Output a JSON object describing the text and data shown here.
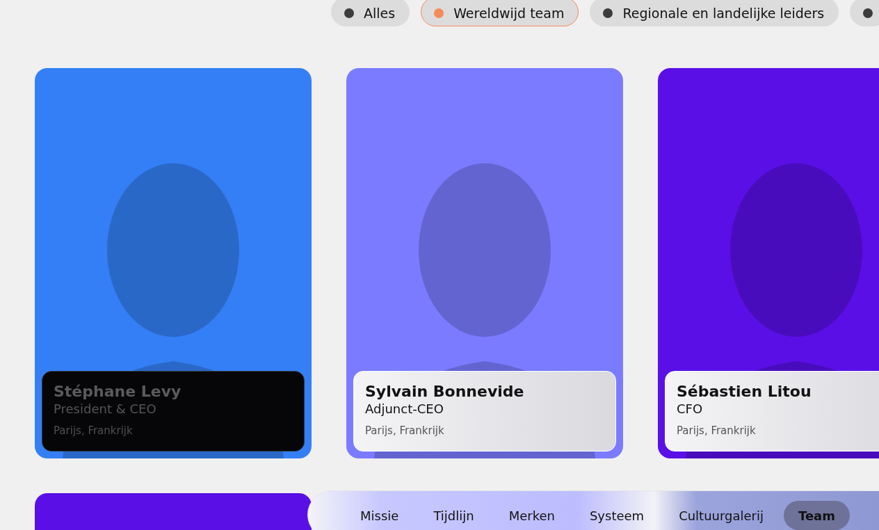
{
  "filters": [
    {
      "label": "Alles",
      "selected": false
    },
    {
      "label": "Wereldwijd team",
      "selected": true
    },
    {
      "label": "Regionale en landelijke leiders",
      "selected": false
    },
    {
      "selected": false
    }
  ],
  "people": [
    {
      "name": "Stéphane Levy",
      "role": "President & CEO",
      "location": "Parijs, Frankrijk",
      "color": "#347ff5",
      "highlighted": true
    },
    {
      "name": "Sylvain Bonnevide",
      "role": "Adjunct-CEO",
      "location": "Parijs, Frankrijk",
      "color": "#7b7bff",
      "highlighted": false
    },
    {
      "name": "Sébastien Litou",
      "role": "CFO",
      "location": "Parijs, Frankrijk",
      "color": "#5a0fe6",
      "highlighted": false
    }
  ],
  "next_row": [
    {
      "color": "#5a0fe6"
    }
  ],
  "nav": [
    {
      "label": "Missie",
      "selected": false
    },
    {
      "label": "Tijdlijn",
      "selected": false
    },
    {
      "label": "Merken",
      "selected": false
    },
    {
      "label": "Systeem",
      "selected": false
    },
    {
      "label": "Cultuurgalerij",
      "selected": false
    },
    {
      "label": "Team",
      "selected": true
    }
  ]
}
